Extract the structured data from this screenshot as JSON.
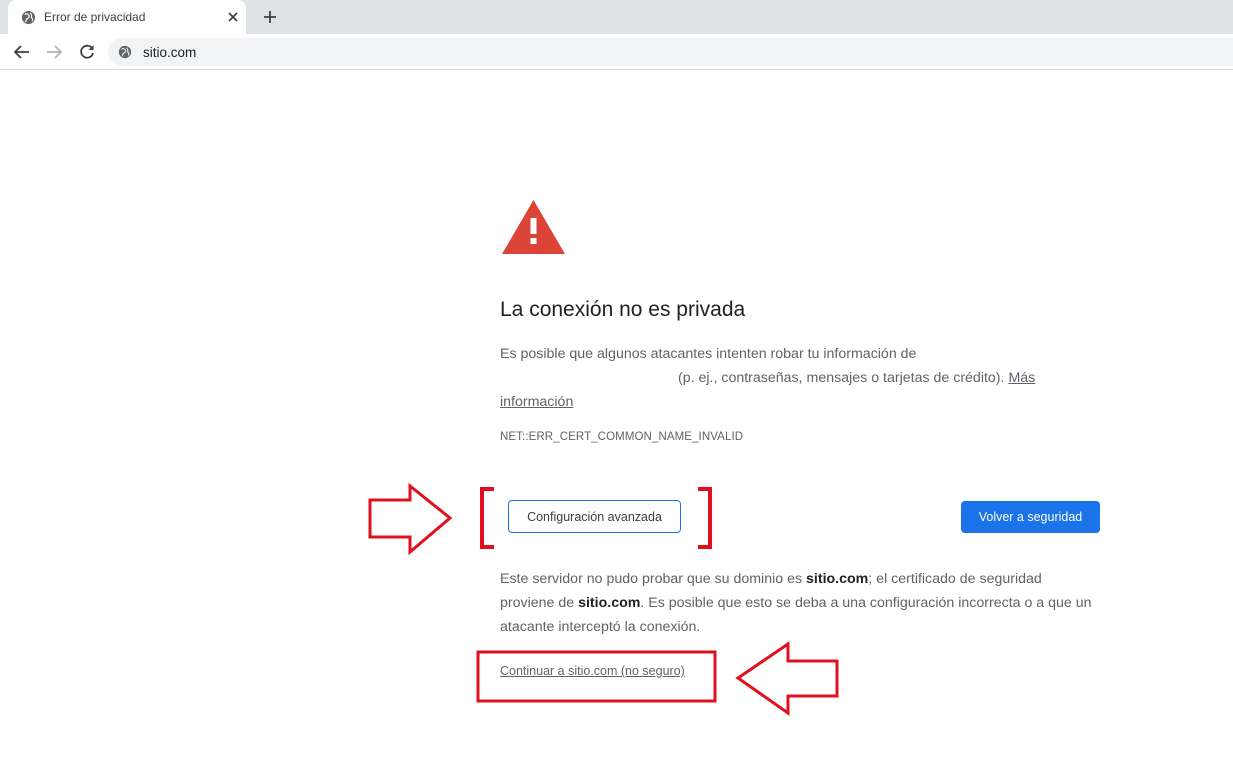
{
  "tab": {
    "title": "Error de privacidad",
    "favicon_icon": "globe-icon",
    "close_icon": "close-icon"
  },
  "toolbar": {
    "back_icon": "arrow-left-icon",
    "forward_icon": "arrow-right-icon",
    "reload_icon": "reload-icon",
    "new_tab_icon": "plus-icon"
  },
  "omnibox": {
    "icon": "globe-icon",
    "url": "sitio.com"
  },
  "interstitial": {
    "icon": "warning-triangle-icon",
    "heading": "La conexión no es privada",
    "intro_line1": "Es posible que algunos atacantes intenten robar tu información de",
    "intro_line2": "(p. ej., contraseñas, mensajes o tarjetas de crédito).",
    "learn_more_part1": "Más",
    "learn_more_part2": "información",
    "error_code": "NET::ERR_CERT_COMMON_NAME_INVALID",
    "advanced_button": "Configuración avanzada",
    "back_button": "Volver a seguridad",
    "details_text1": "Este servidor no pudo probar que su dominio es ",
    "details_domain1": "sitio.com",
    "details_text2": "; el certificado de seguridad proviene de ",
    "details_domain2": "sitio.com",
    "details_text3": ". Es posible que esto se deba a una configuración incorrecta o a que un atacante interceptó la conexión.",
    "proceed_link": "Continuar a sitio.com (no seguro)"
  },
  "colors": {
    "primary_blue": "#1a73e8",
    "warning_red": "#db4437",
    "annotation_red": "#e0101e",
    "tabstrip_bg": "#dee1e6",
    "text_secondary": "#5f6368"
  }
}
